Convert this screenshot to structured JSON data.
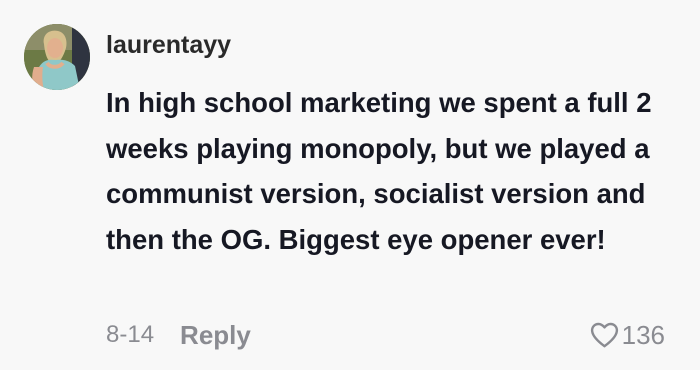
{
  "comment": {
    "username": "laurentayy",
    "text": "In high school marketing we spent a full 2 weeks playing monopoly, but we played a communist version, socialist version and then the OG. Biggest eye opener ever!",
    "date": "8-14",
    "reply_label": "Reply",
    "like_count": "136",
    "icons": {
      "avatar": "profile-photo",
      "like": "heart-outline-icon"
    }
  }
}
